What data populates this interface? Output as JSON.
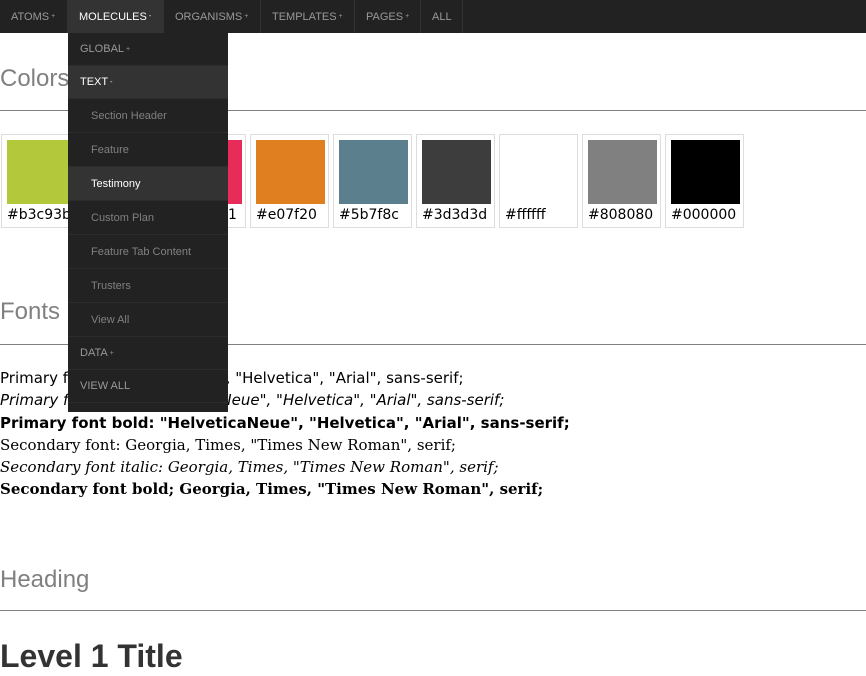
{
  "nav": {
    "items": [
      {
        "label": "ATOMS",
        "caret": "+"
      },
      {
        "label": "MOLECULES",
        "caret": "-"
      },
      {
        "label": "ORGANISMS",
        "caret": "+"
      },
      {
        "label": "TEMPLATES",
        "caret": "+"
      },
      {
        "label": "PAGES",
        "caret": "+"
      },
      {
        "label": "ALL",
        "caret": ""
      }
    ]
  },
  "dropdown": {
    "global": {
      "label": "GLOBAL",
      "caret": "+"
    },
    "text": {
      "label": "TEXT",
      "caret": "-"
    },
    "sub_items": [
      "Section Header",
      "Feature",
      "Testimony",
      "Custom Plan",
      "Feature Tab Content",
      "Trusters",
      "View All"
    ],
    "data": {
      "label": "DATA",
      "caret": "+"
    },
    "view_all": "VIEW ALL"
  },
  "colors": {
    "title": "Colors",
    "swatches": [
      {
        "hex": "#b3c93b",
        "color": "#b3c93b"
      },
      {
        "hex": "#e82c5a",
        "visible_text": "1",
        "color": "#e82c5a"
      },
      {
        "hex": "#e07f20",
        "color": "#e07f20"
      },
      {
        "hex": "#5b7f8c",
        "color": "#5b7f8c"
      },
      {
        "hex": "#3d3d3d",
        "color": "#3d3d3d"
      },
      {
        "hex": "#ffffff",
        "color": "#ffffff"
      },
      {
        "hex": "#808080",
        "color": "#808080"
      },
      {
        "hex": "#000000",
        "color": "#000000"
      }
    ]
  },
  "fonts": {
    "title": "Fonts",
    "lines": {
      "primary": "Primary font: \"HelveticaNeue\", \"Helvetica\", \"Arial\", sans-serif;",
      "primary_italic": "Primary font italic: \"HelveticaNeue\", \"Helvetica\", \"Arial\", sans-serif;",
      "primary_bold": "Primary font bold: \"HelveticaNeue\", \"Helvetica\", \"Arial\", sans-serif;",
      "secondary": "Secondary font: Georgia, Times, \"Times New Roman\", serif;",
      "secondary_italic": "Secondary font italic: Georgia, Times, \"Times New Roman\", serif;",
      "secondary_bold": "Secondary font bold; Georgia, Times, \"Times New Roman\", serif;"
    }
  },
  "heading": {
    "title": "Heading",
    "level1": "Level 1 Title"
  }
}
